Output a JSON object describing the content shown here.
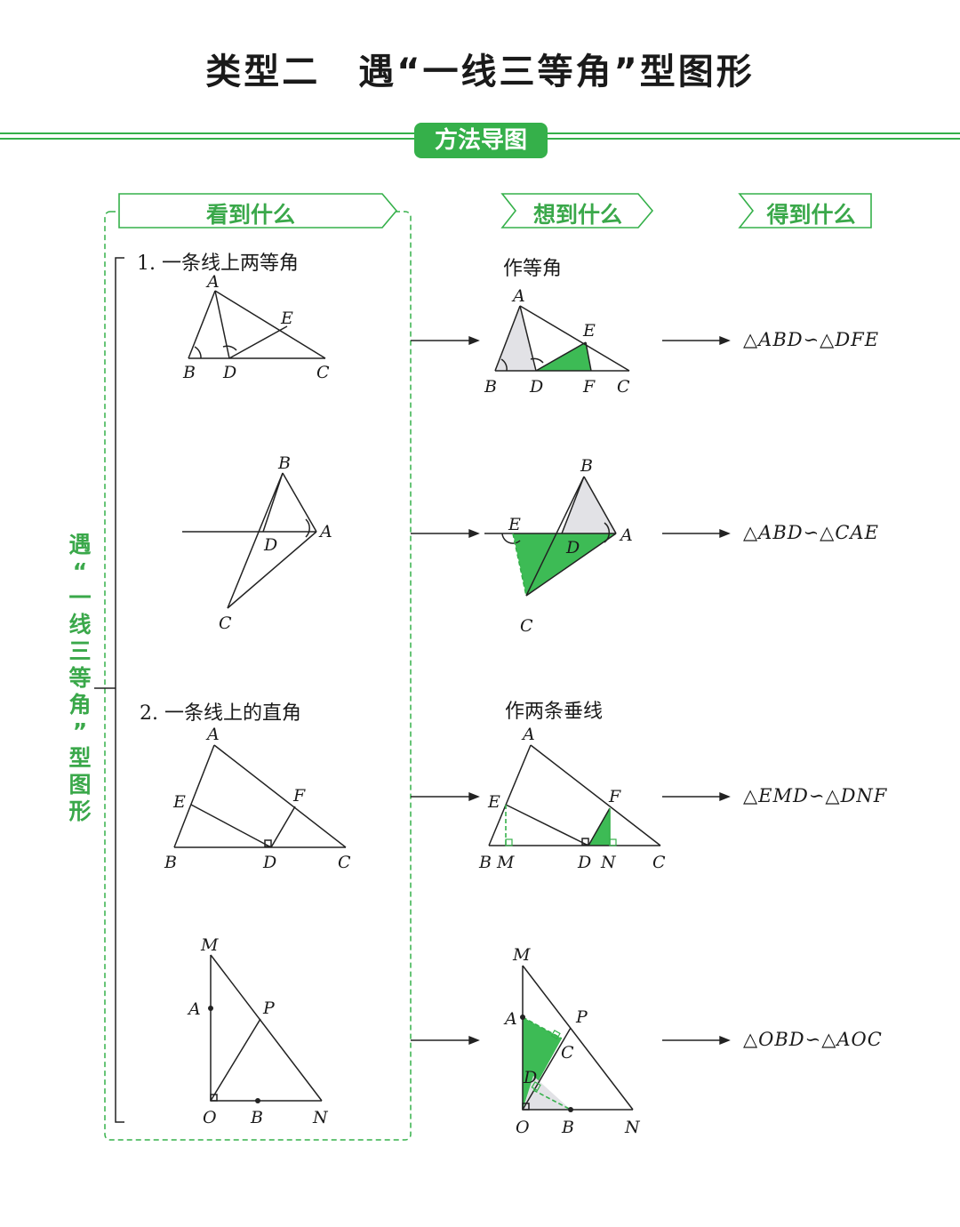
{
  "title": "类型二　遇“一线三等角”型图形",
  "badge": "方法导图",
  "columns": {
    "see": "看到什么",
    "think": "想到什么",
    "get": "得到什么"
  },
  "side_label": [
    "遇",
    "“",
    "一",
    "线",
    "三",
    "等",
    "角",
    "”",
    "型",
    "图",
    "形"
  ],
  "case1": {
    "caption": "1. 一条线上两等角",
    "method": "作等角"
  },
  "case2": {
    "caption": "2. 一条线上的直角",
    "method": "作两条垂线"
  },
  "results": [
    "△ABD∽△DFE",
    "△ABD∽△CAE",
    "△EMD∽△DNF",
    "△OBD∽△AOC"
  ],
  "colors": {
    "accent": "#35b04a",
    "fill_green": "#3dbb55",
    "fill_gray": "#e2e2e6"
  }
}
